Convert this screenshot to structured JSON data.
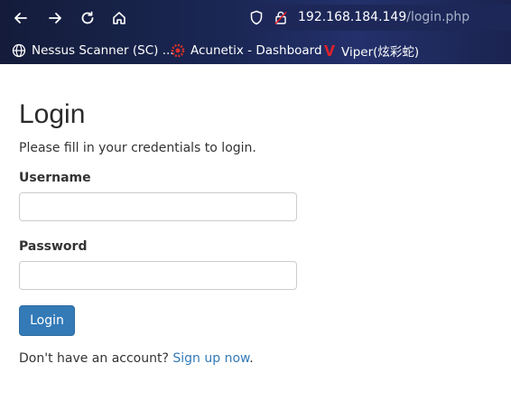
{
  "browser": {
    "url_host": "192.168.184.149",
    "url_path": "/login.php",
    "bookmarks": [
      {
        "label": "Nessus Scanner (SC) ...",
        "icon": "globe-icon"
      },
      {
        "label": "Acunetix - Dashboard",
        "icon": "acunetix-icon"
      },
      {
        "label": "Viper(炫彩蛇)",
        "icon": "viper-icon"
      }
    ]
  },
  "page": {
    "title": "Login",
    "subtitle": "Please fill in your credentials to login.",
    "username_label": "Username",
    "username_value": "",
    "password_label": "Password",
    "password_value": "",
    "login_button": "Login",
    "footer_text": "Don't have an account? ",
    "signup_link": "Sign up now",
    "footer_end": "."
  },
  "colors": {
    "primary": "#337ab7",
    "viper_red": "#e0202a"
  }
}
